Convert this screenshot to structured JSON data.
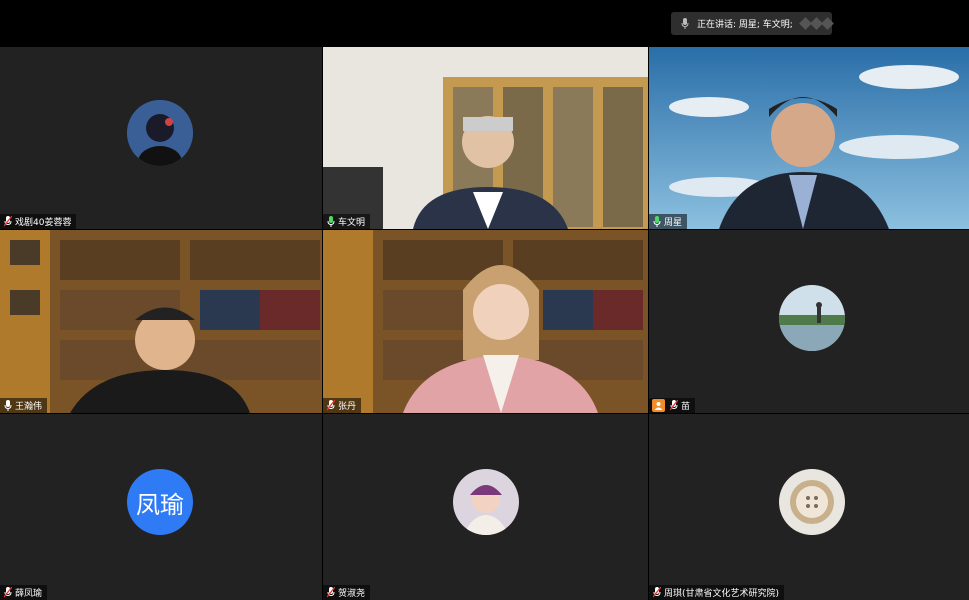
{
  "status_bar": {
    "speaking_label": "正在讲话: 周星; 车文明;"
  },
  "participants": [
    {
      "name": "戏剧40姜蓉蓉"
    },
    {
      "name": "车文明"
    },
    {
      "name": "周星"
    },
    {
      "name": "王瀚伟"
    },
    {
      "name": "张丹"
    },
    {
      "name": "苗"
    },
    {
      "name": "薛凤瑜",
      "avatar_text": "凤瑜"
    },
    {
      "name": "贺淑尧"
    },
    {
      "name": "周琪(甘肃省文化艺术研究院)"
    }
  ],
  "colors": {
    "active_speaker_border": "#4cd964",
    "avatar_blue": "#2f7bf5",
    "tile_bg": "#222222"
  }
}
